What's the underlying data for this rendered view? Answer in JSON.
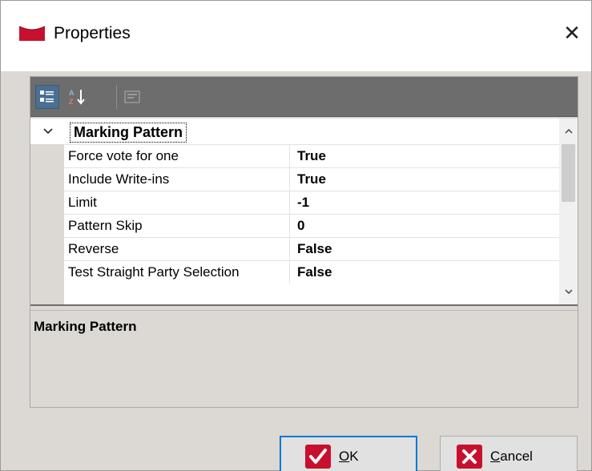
{
  "window": {
    "title": "Properties",
    "close_glyph": "✕"
  },
  "toolbar": {
    "buttons": [
      {
        "icon": "categorized-icon",
        "state": "active"
      },
      {
        "icon": "alphabetical-sort-icon",
        "state": "normal"
      },
      {
        "icon": "property-pages-icon",
        "state": "disabled"
      }
    ]
  },
  "grid": {
    "category": "Marking Pattern",
    "properties": [
      {
        "name": "Force vote for one",
        "value": "True"
      },
      {
        "name": "Include Write-ins",
        "value": "True"
      },
      {
        "name": "Limit",
        "value": "-1"
      },
      {
        "name": "Pattern Skip",
        "value": "0"
      },
      {
        "name": "Reverse",
        "value": "False"
      },
      {
        "name": "Test Straight Party Selection",
        "value": "False"
      }
    ]
  },
  "description": {
    "title": "Marking Pattern"
  },
  "buttons": {
    "ok_mnemonic": "O",
    "ok_rest": "K",
    "cancel_mnemonic": "C",
    "cancel_rest": "ancel"
  },
  "colors": {
    "toolbar": "#6d6d6d",
    "client": "#dcd8d4",
    "accent_red": "#c8102e",
    "default_button_border": "#0078d7"
  }
}
